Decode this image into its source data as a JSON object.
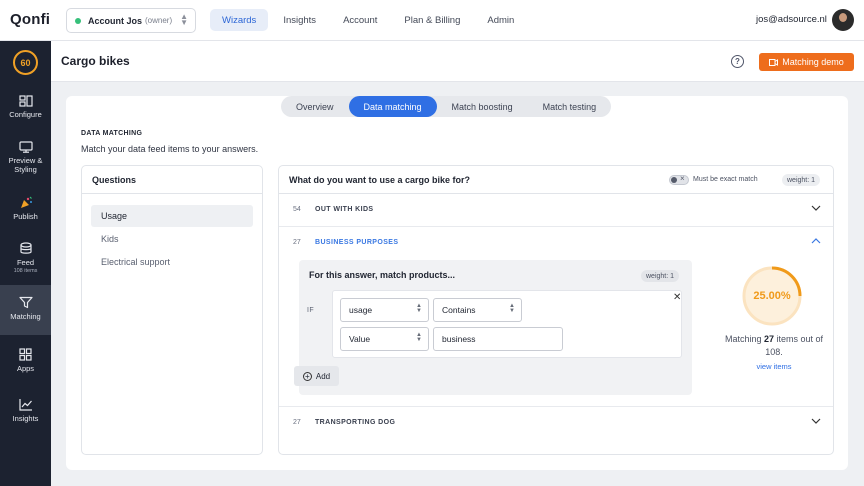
{
  "topbar": {
    "logo": "Qonfi",
    "account": {
      "name": "Account Jos",
      "role": "(owner)"
    },
    "nav": [
      "Wizards",
      "Insights",
      "Account",
      "Plan & Billing",
      "Admin"
    ],
    "active_nav": "Wizards",
    "user_email": "jos@adsource.nl"
  },
  "sidebar": {
    "score": "60",
    "items": [
      {
        "label": "Configure",
        "icon": "configure-icon"
      },
      {
        "label": "Preview &",
        "label2": "Styling",
        "icon": "monitor-icon"
      },
      {
        "label": "Publish",
        "icon": "party-popper-icon"
      },
      {
        "label": "Feed",
        "sub": "108 items",
        "icon": "database-icon"
      },
      {
        "label": "Matching",
        "icon": "filter-icon"
      },
      {
        "label": "Apps",
        "icon": "apps-grid-icon"
      },
      {
        "label": "Insights",
        "icon": "chart-line-icon"
      }
    ],
    "active": "Matching"
  },
  "header": {
    "title": "Cargo bikes",
    "demo_button": "Matching demo"
  },
  "tabs": [
    "Overview",
    "Data matching",
    "Match boosting",
    "Match testing"
  ],
  "active_tab": "Data matching",
  "section": {
    "label": "DATA MATCHING",
    "description": "Match your data feed items to your answers."
  },
  "questions": {
    "header": "Questions",
    "items": [
      "Usage",
      "Kids",
      "Electrical support"
    ],
    "active": "Usage"
  },
  "answers": {
    "question": "What do you want to use a cargo bike for?",
    "exact_label": "Must be exact match",
    "weight": "weight: 1",
    "rows": [
      {
        "count": "54",
        "label": "OUT WITH KIDS"
      },
      {
        "count": "27",
        "label": "BUSINESS PURPOSES"
      },
      {
        "count": "27",
        "label": "TRANSPORTING DOG"
      }
    ],
    "match_box": {
      "title": "For this answer, match products...",
      "weight": "weight: 1",
      "if_label": "IF",
      "field": "usage",
      "operator": "Contains",
      "value_type": "Value",
      "value": "business",
      "add_label": "Add"
    },
    "stats": {
      "percent_label": "25.00%",
      "percent": 25,
      "text_before": "Matching ",
      "count": "27",
      "text_after": " items out of 108.",
      "view_items": "view items"
    }
  },
  "colors": {
    "accent": "#2f6fe4",
    "orange": "#ee6d1c",
    "donut": "#f09a1a"
  }
}
